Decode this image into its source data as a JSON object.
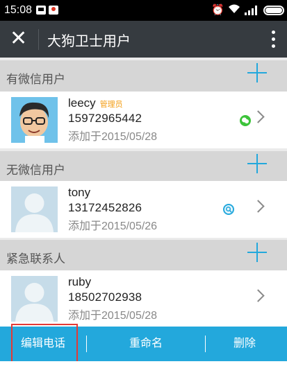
{
  "status_bar": {
    "time": "15:08",
    "icons": [
      "notification-icon",
      "qq-icon",
      "alarm-icon",
      "wifi-icon",
      "signal-icon",
      "battery-icon"
    ]
  },
  "title_bar": {
    "title": "大狗卫士用户",
    "icons": [
      "close-icon",
      "more-vert-icon"
    ]
  },
  "sections": [
    {
      "title": "有微信用户",
      "users": [
        {
          "name": "leecy",
          "badge": "管理员",
          "phone": "15972965442",
          "added": "添加于2015/05/28",
          "status_icon": "wechat-icon",
          "status_color": "#3cc33a"
        }
      ]
    },
    {
      "title": "无微信用户",
      "users": [
        {
          "name": "tony",
          "badge": "",
          "phone": "13172452826",
          "added": "添加于2015/05/26",
          "status_icon": "search-icon",
          "status_color": "#23a8dc"
        }
      ]
    },
    {
      "title": "紧急联系人",
      "users": [
        {
          "name": "ruby",
          "badge": "",
          "phone": "18502702938",
          "added": "添加于2015/05/28",
          "status_icon": "",
          "status_color": ""
        }
      ]
    }
  ],
  "bottom_bar": {
    "edit_phone": "编辑电话",
    "rename": "重命名",
    "delete": "删除"
  },
  "colors": {
    "accent": "#23a8dc",
    "title_bar": "#363b40",
    "section_bg": "#d6d6d6",
    "highlight": "#e53935"
  }
}
